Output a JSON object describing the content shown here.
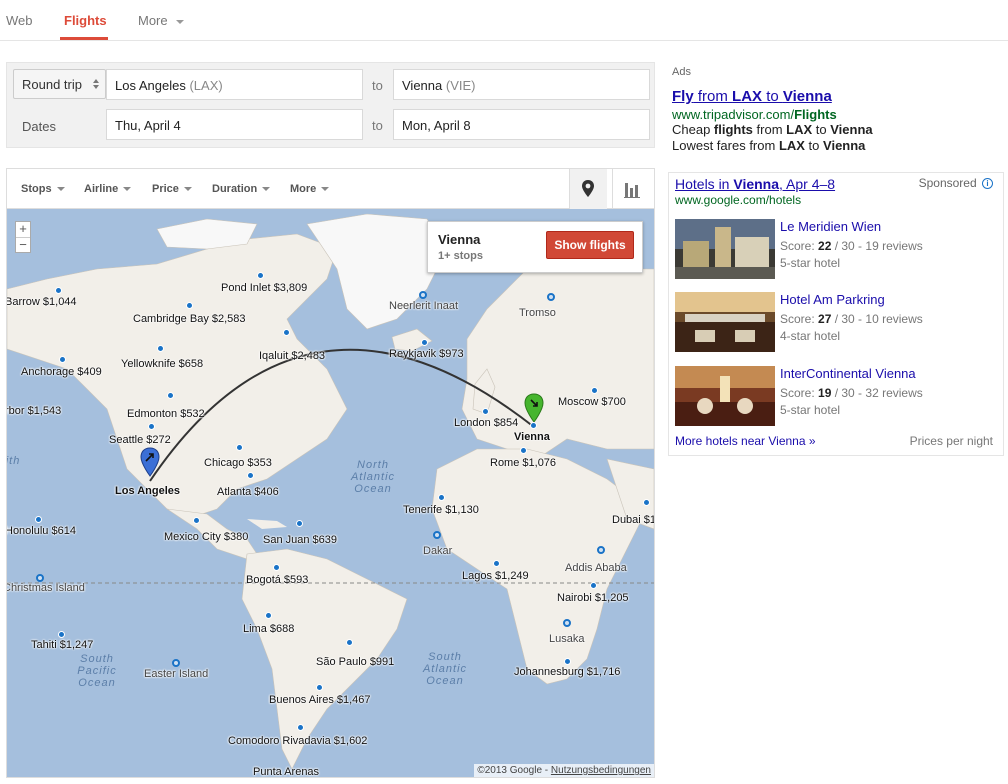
{
  "nav": {
    "tabs": [
      {
        "label": "Web"
      },
      {
        "label": "Flights"
      },
      {
        "label": "More"
      }
    ]
  },
  "search": {
    "trip_type": "Round trip",
    "origin_city": "Los Angeles",
    "origin_code": "(LAX)",
    "destination_city": "Vienna",
    "destination_code": "(VIE)",
    "to_label": "to",
    "dates_label": "Dates",
    "depart_date": "Thu, April 4",
    "return_date": "Mon, April 8"
  },
  "filters": [
    "Stops",
    "Airline",
    "Price",
    "Duration",
    "More"
  ],
  "map": {
    "zoom_in": "+",
    "zoom_out": "−",
    "popup": {
      "city": "Vienna",
      "stops": "1+ stops",
      "button": "Show flights"
    },
    "copyright": "©2013 Google - ",
    "terms": "Nutzungsbedingungen",
    "origin_label": "Los Angeles",
    "destination_label": "Vienna",
    "oceans": {
      "north_atlantic": "North Atlantic Ocean",
      "south_atlantic": "South Atlantic Ocean",
      "south_pacific": "South Pacific Ocean"
    },
    "cities": [
      {
        "label": "Barrow $1,044"
      },
      {
        "label": "Pond Inlet $3,809"
      },
      {
        "label": "Cambridge Bay $2,583"
      },
      {
        "label": "Neerlerit Inaat"
      },
      {
        "label": "Tromso"
      },
      {
        "label": "Iqaluit $2,483"
      },
      {
        "label": "Reykjavik $973"
      },
      {
        "label": "Yellowknife $658"
      },
      {
        "label": "Anchorage $409"
      },
      {
        "label": "Edmonton $532"
      },
      {
        "label": "rbor $1,543"
      },
      {
        "label": "Seattle $272"
      },
      {
        "label": "Chicago $353"
      },
      {
        "label": "Atlanta $406"
      },
      {
        "label": "Moscow $700"
      },
      {
        "label": "London $854"
      },
      {
        "label": "Rome $1,076"
      },
      {
        "label": "Tenerife $1,130"
      },
      {
        "label": "Dubai $1"
      },
      {
        "label": "Honolulu $614"
      },
      {
        "label": "Mexico City $380"
      },
      {
        "label": "San Juan $639"
      },
      {
        "label": "Dakar"
      },
      {
        "label": "Addis Ababa"
      },
      {
        "label": "Bogotá $593"
      },
      {
        "label": "Lagos $1,249"
      },
      {
        "label": "Christmas Island"
      },
      {
        "label": "Nairobi $1,205"
      },
      {
        "label": "Lima $688"
      },
      {
        "label": "Tahiti $1,247"
      },
      {
        "label": "Lusaka"
      },
      {
        "label": "São Paulo $991"
      },
      {
        "label": "Easter Island"
      },
      {
        "label": "Johannesburg $1,716"
      },
      {
        "label": "Buenos Aires $1,467"
      },
      {
        "label": "Comodoro Rivadavia $1,602"
      },
      {
        "label": "Punta Arenas"
      },
      {
        "label": "ith"
      }
    ]
  },
  "ads": {
    "label": "Ads",
    "ad1": {
      "title_part1": "Fly",
      "title_part2": " from ",
      "title_part3": "LAX",
      "title_part4": " to ",
      "title_part5": "Vienna",
      "url_part1": "www.tripadvisor.com/",
      "url_part2": "Flights",
      "line1_a": "Cheap ",
      "line1_b": "flights",
      "line1_c": " from ",
      "line1_d": "LAX",
      "line1_e": " to ",
      "line1_f": "Vienna",
      "line2_a": "Lowest fares from ",
      "line2_b": "LAX",
      "line2_c": " to ",
      "line2_d": "Vienna"
    }
  },
  "hotels": {
    "title_a": "Hotels in ",
    "title_b": "Vienna",
    "title_c": ", Apr 4–8",
    "sponsored": "Sponsored",
    "info_glyph": "i",
    "url": "www.google.com/hotels",
    "items": [
      {
        "name": "Le Meridien Wien",
        "score_prefix": "Score: ",
        "score": "22",
        "score_suffix": " / 30 - 19 reviews",
        "stars": "5-star hotel"
      },
      {
        "name": "Hotel Am Parkring",
        "score_prefix": "Score: ",
        "score": "27",
        "score_suffix": " / 30 - 10 reviews",
        "stars": "4-star hotel"
      },
      {
        "name": "InterContinental Vienna",
        "score_prefix": "Score: ",
        "score": "19",
        "score_suffix": " / 30 - 32 reviews",
        "stars": "5-star hotel"
      }
    ],
    "more_link": "More hotels near Vienna »",
    "prices_note": "Prices per night"
  },
  "colors": {
    "accent": "#dd4b39",
    "link": "#1a0dab",
    "url_green": "#006621",
    "ocean": "#a5bfdd",
    "land": "#f2efe9",
    "route": "#333333",
    "pin_origin": "#3b6fd6",
    "pin_destination": "#46b52e"
  }
}
